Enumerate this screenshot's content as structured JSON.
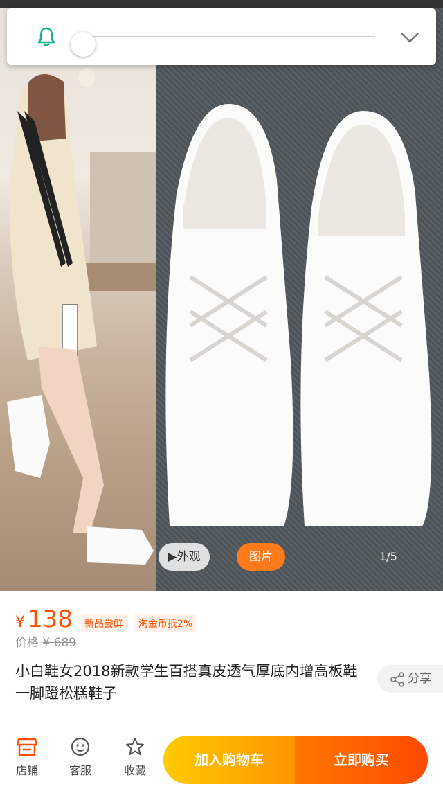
{
  "gallery": {
    "video_label": "外观",
    "photo_label": "图片",
    "page_counter": "1/5"
  },
  "slider": {
    "level": 0
  },
  "product": {
    "currency": "¥",
    "price": "138",
    "tags": [
      "新品尝鲜",
      "淘金币抵2%"
    ],
    "original_label": "价格",
    "original_price": "¥ 689",
    "title": "小白鞋女2018新款学生百搭真皮透气厚底内增高板鞋一脚蹬松糕鞋子",
    "share_label": "分享"
  },
  "bottom_bar": {
    "store": "店铺",
    "service": "客服",
    "favorite": "收藏",
    "add_to_cart": "加入购物车",
    "buy_now": "立即购买"
  },
  "colors": {
    "accent": "#ff5000",
    "cart_button": "#ffa200",
    "buy_button": "#ff5500"
  },
  "icons": [
    "bell-icon",
    "chevron-down-icon",
    "play-icon",
    "share-icon",
    "store-icon",
    "service-icon",
    "star-icon"
  ]
}
